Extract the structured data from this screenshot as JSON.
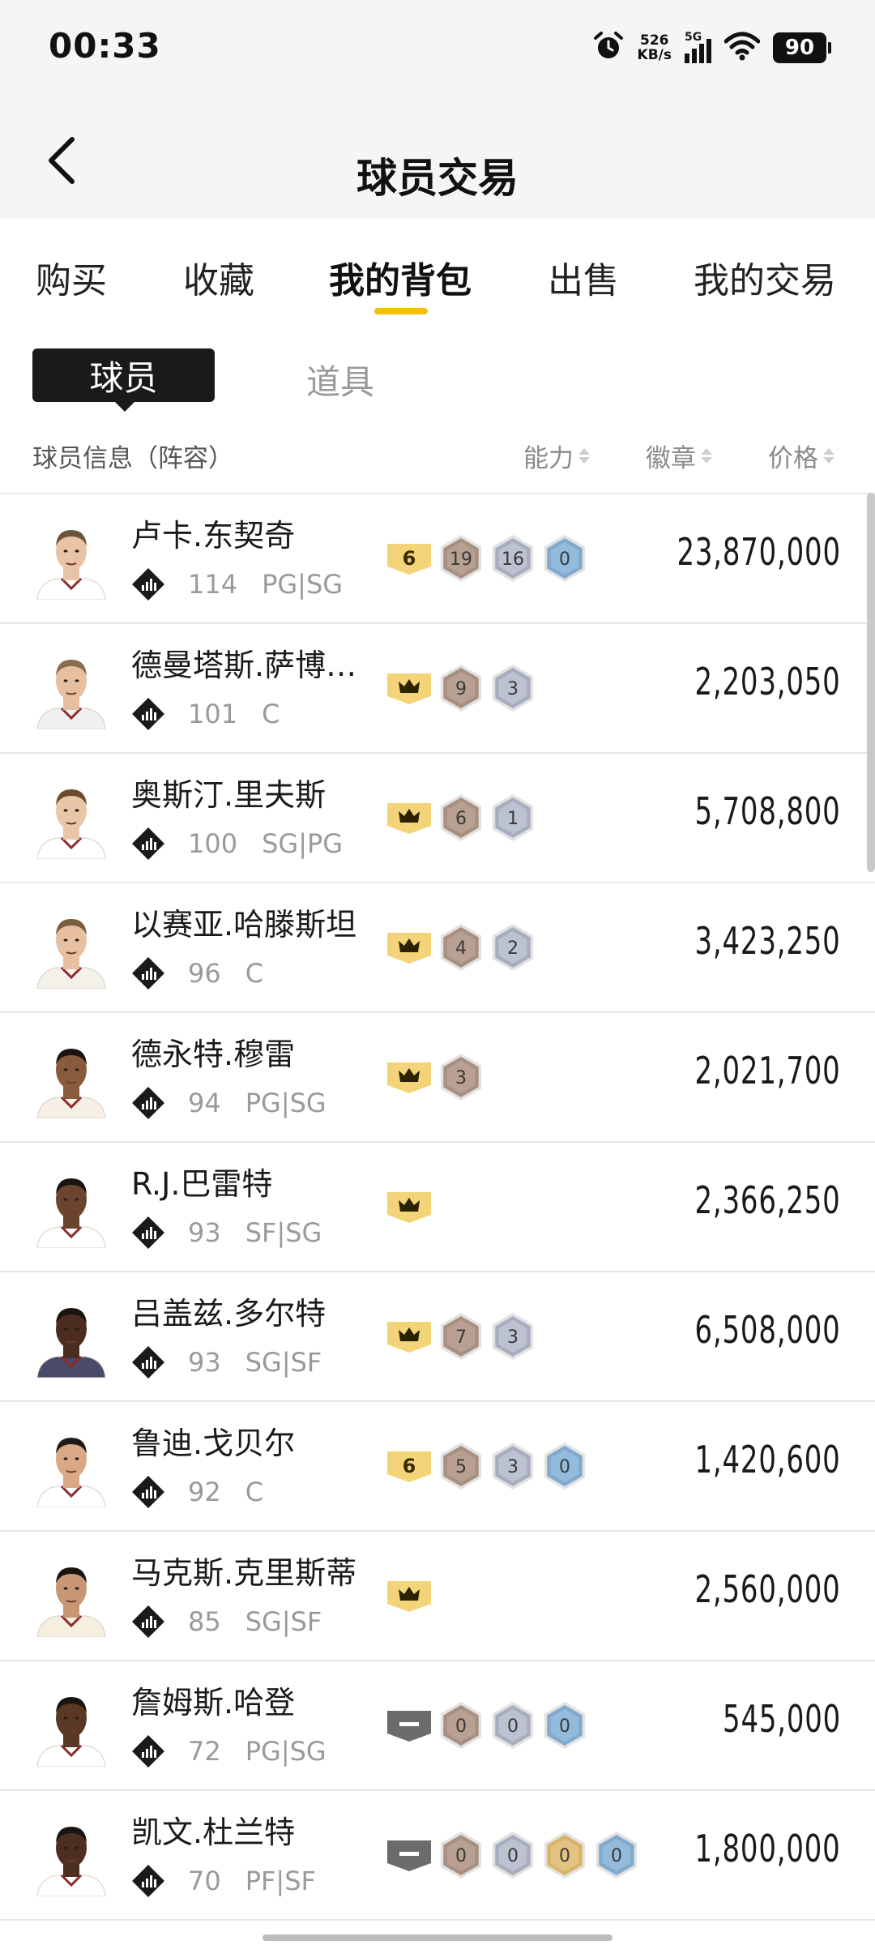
{
  "status_bar": {
    "time": "00:33",
    "net_speed_value": "526",
    "net_speed_unit": "KB/s",
    "network": "5G",
    "battery": "90"
  },
  "header": {
    "title": "球员交易"
  },
  "tabs": [
    {
      "label": "购买",
      "active": false
    },
    {
      "label": "收藏",
      "active": false
    },
    {
      "label": "我的背包",
      "active": true
    },
    {
      "label": "出售",
      "active": false
    },
    {
      "label": "我的交易",
      "active": false
    }
  ],
  "subtabs": {
    "active": "球员",
    "other": "道具"
  },
  "columns": {
    "info": "球员信息（阵容）",
    "ability": "能力",
    "badges": "徽章",
    "price": "价格"
  },
  "colors": {
    "accent_yellow": "#f2c200",
    "badge_gold": "#f3d478",
    "badge_bronze": "#a89080",
    "badge_silver": "#a6adbd",
    "badge_blue": "#7fa9cd",
    "badge_gold_hex": "#d8b36a",
    "badge_gray": "#6b6b6b"
  },
  "players": [
    {
      "name": "卢卡.东契奇",
      "ovr": "114",
      "pos": "PG|SG",
      "price": "23,870,000",
      "rank": {
        "type": "number",
        "value": "6"
      },
      "badges": [
        {
          "kind": "bronze",
          "count": "19"
        },
        {
          "kind": "silver",
          "count": "16"
        },
        {
          "kind": "blue",
          "count": "0"
        }
      ]
    },
    {
      "name": "德曼塔斯.萨博…",
      "ovr": "101",
      "pos": "C",
      "price": "2,203,050",
      "rank": {
        "type": "crown"
      },
      "badges": [
        {
          "kind": "bronze",
          "count": "9"
        },
        {
          "kind": "silver",
          "count": "3"
        }
      ]
    },
    {
      "name": "奥斯汀.里夫斯",
      "ovr": "100",
      "pos": "SG|PG",
      "price": "5,708,800",
      "rank": {
        "type": "crown"
      },
      "badges": [
        {
          "kind": "bronze",
          "count": "6"
        },
        {
          "kind": "silver",
          "count": "1"
        }
      ]
    },
    {
      "name": "以赛亚.哈滕斯坦",
      "ovr": "96",
      "pos": "C",
      "price": "3,423,250",
      "rank": {
        "type": "crown"
      },
      "badges": [
        {
          "kind": "bronze",
          "count": "4"
        },
        {
          "kind": "silver",
          "count": "2"
        }
      ]
    },
    {
      "name": "德永特.穆雷",
      "ovr": "94",
      "pos": "PG|SG",
      "price": "2,021,700",
      "rank": {
        "type": "crown"
      },
      "badges": [
        {
          "kind": "bronze",
          "count": "3"
        }
      ]
    },
    {
      "name": "R.J.巴雷特",
      "ovr": "93",
      "pos": "SF|SG",
      "price": "2,366,250",
      "rank": {
        "type": "crown"
      },
      "badges": []
    },
    {
      "name": "吕盖兹.多尔特",
      "ovr": "93",
      "pos": "SG|SF",
      "price": "6,508,000",
      "rank": {
        "type": "crown"
      },
      "badges": [
        {
          "kind": "bronze",
          "count": "7"
        },
        {
          "kind": "silver",
          "count": "3"
        }
      ]
    },
    {
      "name": "鲁迪.戈贝尔",
      "ovr": "92",
      "pos": "C",
      "price": "1,420,600",
      "rank": {
        "type": "number",
        "value": "6"
      },
      "badges": [
        {
          "kind": "bronze",
          "count": "5"
        },
        {
          "kind": "silver",
          "count": "3"
        },
        {
          "kind": "blue",
          "count": "0"
        }
      ]
    },
    {
      "name": "马克斯.克里斯蒂",
      "ovr": "85",
      "pos": "SG|SF",
      "price": "2,560,000",
      "rank": {
        "type": "crown"
      },
      "badges": []
    },
    {
      "name": "詹姆斯.哈登",
      "ovr": "72",
      "pos": "PG|SG",
      "price": "545,000",
      "rank": {
        "type": "dash"
      },
      "badges": [
        {
          "kind": "bronze",
          "count": "0"
        },
        {
          "kind": "silver",
          "count": "0"
        },
        {
          "kind": "blue",
          "count": "0"
        }
      ]
    },
    {
      "name": "凯文.杜兰特",
      "ovr": "70",
      "pos": "PF|SF",
      "price": "1,800,000",
      "rank": {
        "type": "dash"
      },
      "badges": [
        {
          "kind": "bronze",
          "count": "0"
        },
        {
          "kind": "silver",
          "count": "0"
        },
        {
          "kind": "gold",
          "count": "0"
        },
        {
          "kind": "blue",
          "count": "0"
        }
      ]
    }
  ],
  "icons": {
    "back": "chevron-left-icon",
    "alarm": "alarm-clock-icon",
    "wifi": "wifi-icon",
    "rating": "rating-diamond-icon",
    "crown": "crown-icon"
  }
}
